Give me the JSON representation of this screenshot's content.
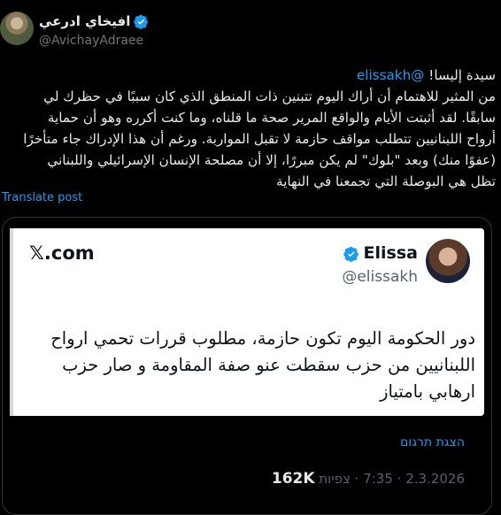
{
  "author": {
    "name": "افيخاي ادرعي",
    "handle": "@AvichayAdraee"
  },
  "post": {
    "mention": "@elissakh",
    "opening": "سيدة إليسا!",
    "lines": [
      "من المثير للاهتمام أن أراك اليوم تتبنين ذات المنطق الذي كان سببًا  في حظرك لي",
      "سابقًا. لقد أثبتت الأيام والواقع المرير صحة ما قلناه، وما كنت أكرره وهو أن حماية",
      "أرواح اللبنانيين تتطلب مواقف حازمة لا تقبل المواربة. ورغم أن هذا الإدراك جاء متأخرًا",
      "(عفوًا منك) وبعد \"بلوك\" لم يكن مبررًا، إلا أن مصلحة الإنسان الإسرائيلي واللبناني",
      "تظل هي البوصلة التي تجمعنا في النهاية"
    ],
    "translate_label": "Translate post"
  },
  "quote": {
    "site": "𝕏.com",
    "name": "Elissa",
    "handle": "@elissakh",
    "text": "دور الحكومة اليوم تكون حازمة، مطلوب قررات تحمي ارواح اللبنانيين من حزب سقطت عنو صفة المقاومة و صار حزب ارهابي بامتياز",
    "show_translation": "הצגת תרגום",
    "date": "2.3.2026",
    "time": "7:35",
    "views_label": "צפיות",
    "views": "162K"
  },
  "colors": {
    "accent": "#1d9bf0",
    "background": "#000000"
  }
}
